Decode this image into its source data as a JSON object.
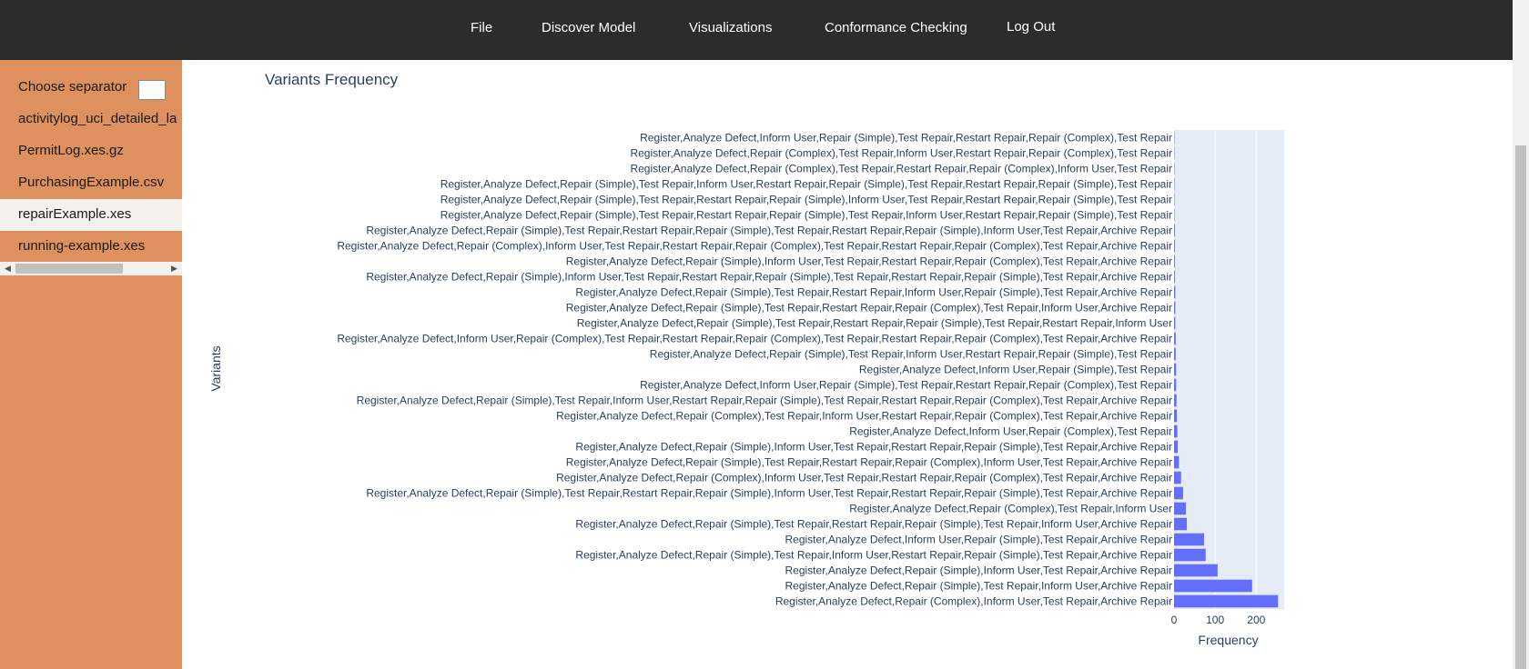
{
  "nav": {
    "items": [
      "File",
      "Discover Model",
      "Visualizations",
      "Conformance Checking",
      "Log Out"
    ]
  },
  "sidebar": {
    "separator_label": "Choose separator",
    "separator_value": "",
    "files": [
      "activitylog_uci_detailed_la",
      "PermitLog.xes.gz",
      "PurchasingExample.csv",
      "repairExample.xes",
      "running-example.xes"
    ],
    "selected_file": "repairExample.xes"
  },
  "chart_data": {
    "type": "bar",
    "orientation": "horizontal",
    "title": "Variants Frequency",
    "xlabel": "Frequency",
    "ylabel": "Variants",
    "xlim": [
      0,
      268
    ],
    "xticks": [
      0,
      100,
      200
    ],
    "grid": true,
    "categories": [
      "Register,Analyze Defect,Repair (Complex),Inform User,Test Repair,Archive Repair",
      "Register,Analyze Defect,Repair (Simple),Test Repair,Inform User,Archive Repair",
      "Register,Analyze Defect,Repair (Simple),Inform User,Test Repair,Archive Repair",
      "Register,Analyze Defect,Repair (Simple),Test Repair,Inform User,Restart Repair,Repair (Simple),Test Repair,Archive Repair",
      "Register,Analyze Defect,Inform User,Repair (Simple),Test Repair,Archive Repair",
      "Register,Analyze Defect,Repair (Simple),Test Repair,Restart Repair,Repair (Simple),Test Repair,Inform User,Archive Repair",
      "Register,Analyze Defect,Repair (Complex),Test Repair,Inform User",
      "Register,Analyze Defect,Repair (Simple),Test Repair,Restart Repair,Repair (Simple),Inform User,Test Repair,Restart Repair,Repair (Simple),Test Repair,Archive Repair",
      "Register,Analyze Defect,Repair (Complex),Inform User,Test Repair,Restart Repair,Repair (Complex),Test Repair,Archive Repair",
      "Register,Analyze Defect,Repair (Simple),Test Repair,Restart Repair,Repair (Complex),Inform User,Test Repair,Archive Repair",
      "Register,Analyze Defect,Repair (Simple),Inform User,Test Repair,Restart Repair,Repair (Simple),Test Repair,Archive Repair",
      "Register,Analyze Defect,Inform User,Repair (Complex),Test Repair",
      "Register,Analyze Defect,Repair (Complex),Test Repair,Inform User,Restart Repair,Repair (Complex),Test Repair,Archive Repair",
      "Register,Analyze Defect,Repair (Simple),Test Repair,Inform User,Restart Repair,Repair (Simple),Test Repair,Restart Repair,Repair (Complex),Test Repair,Archive Repair",
      "Register,Analyze Defect,Inform User,Repair (Simple),Test Repair,Restart Repair,Repair (Complex),Test Repair",
      "Register,Analyze Defect,Inform User,Repair (Simple),Test Repair",
      "Register,Analyze Defect,Repair (Simple),Test Repair,Inform User,Restart Repair,Repair (Simple),Test Repair",
      "Register,Analyze Defect,Inform User,Repair (Complex),Test Repair,Restart Repair,Repair (Complex),Test Repair,Restart Repair,Repair (Complex),Test Repair,Archive Repair",
      "Register,Analyze Defect,Repair (Simple),Test Repair,Restart Repair,Repair (Simple),Test Repair,Restart Repair,Inform User",
      "Register,Analyze Defect,Repair (Simple),Test Repair,Restart Repair,Repair (Complex),Test Repair,Inform User,Archive Repair",
      "Register,Analyze Defect,Repair (Simple),Test Repair,Restart Repair,Inform User,Repair (Simple),Test Repair,Archive Repair",
      "Register,Analyze Defect,Repair (Simple),Inform User,Test Repair,Restart Repair,Repair (Simple),Test Repair,Restart Repair,Repair (Simple),Test Repair,Archive Repair",
      "Register,Analyze Defect,Repair (Simple),Inform User,Test Repair,Restart Repair,Repair (Complex),Test Repair,Archive Repair",
      "Register,Analyze Defect,Repair (Complex),Inform User,Test Repair,Restart Repair,Repair (Complex),Test Repair,Restart Repair,Repair (Complex),Test Repair,Archive Repair",
      "Register,Analyze Defect,Repair (Simple),Test Repair,Restart Repair,Repair (Simple),Test Repair,Restart Repair,Repair (Simple),Inform User,Test Repair,Archive Repair",
      "Register,Analyze Defect,Repair (Simple),Test Repair,Restart Repair,Repair (Simple),Test Repair,Inform User,Restart Repair,Repair (Simple),Test Repair",
      "Register,Analyze Defect,Repair (Simple),Test Repair,Restart Repair,Repair (Simple),Inform User,Test Repair,Restart Repair,Repair (Simple),Test Repair",
      "Register,Analyze Defect,Repair (Simple),Test Repair,Inform User,Restart Repair,Repair (Simple),Test Repair,Restart Repair,Repair (Simple),Test Repair",
      "Register,Analyze Defect,Repair (Complex),Test Repair,Restart Repair,Repair (Complex),Inform User,Test Repair",
      "Register,Analyze Defect,Repair (Complex),Test Repair,Inform User,Restart Repair,Repair (Complex),Test Repair",
      "Register,Analyze Defect,Inform User,Repair (Simple),Test Repair,Restart Repair,Repair (Complex),Test Repair"
    ],
    "values": [
      253,
      190,
      106,
      77,
      73,
      31,
      29,
      22,
      17,
      12,
      9,
      8,
      7,
      6,
      5,
      5,
      4,
      4,
      3,
      3,
      3,
      2,
      2,
      2,
      2,
      1,
      1,
      1,
      1,
      1,
      1
    ],
    "colors": {
      "bar": "#636efa",
      "plot_bg": "#e5ecf6",
      "grid": "#ffffff",
      "text": "#2a3f5f"
    }
  }
}
